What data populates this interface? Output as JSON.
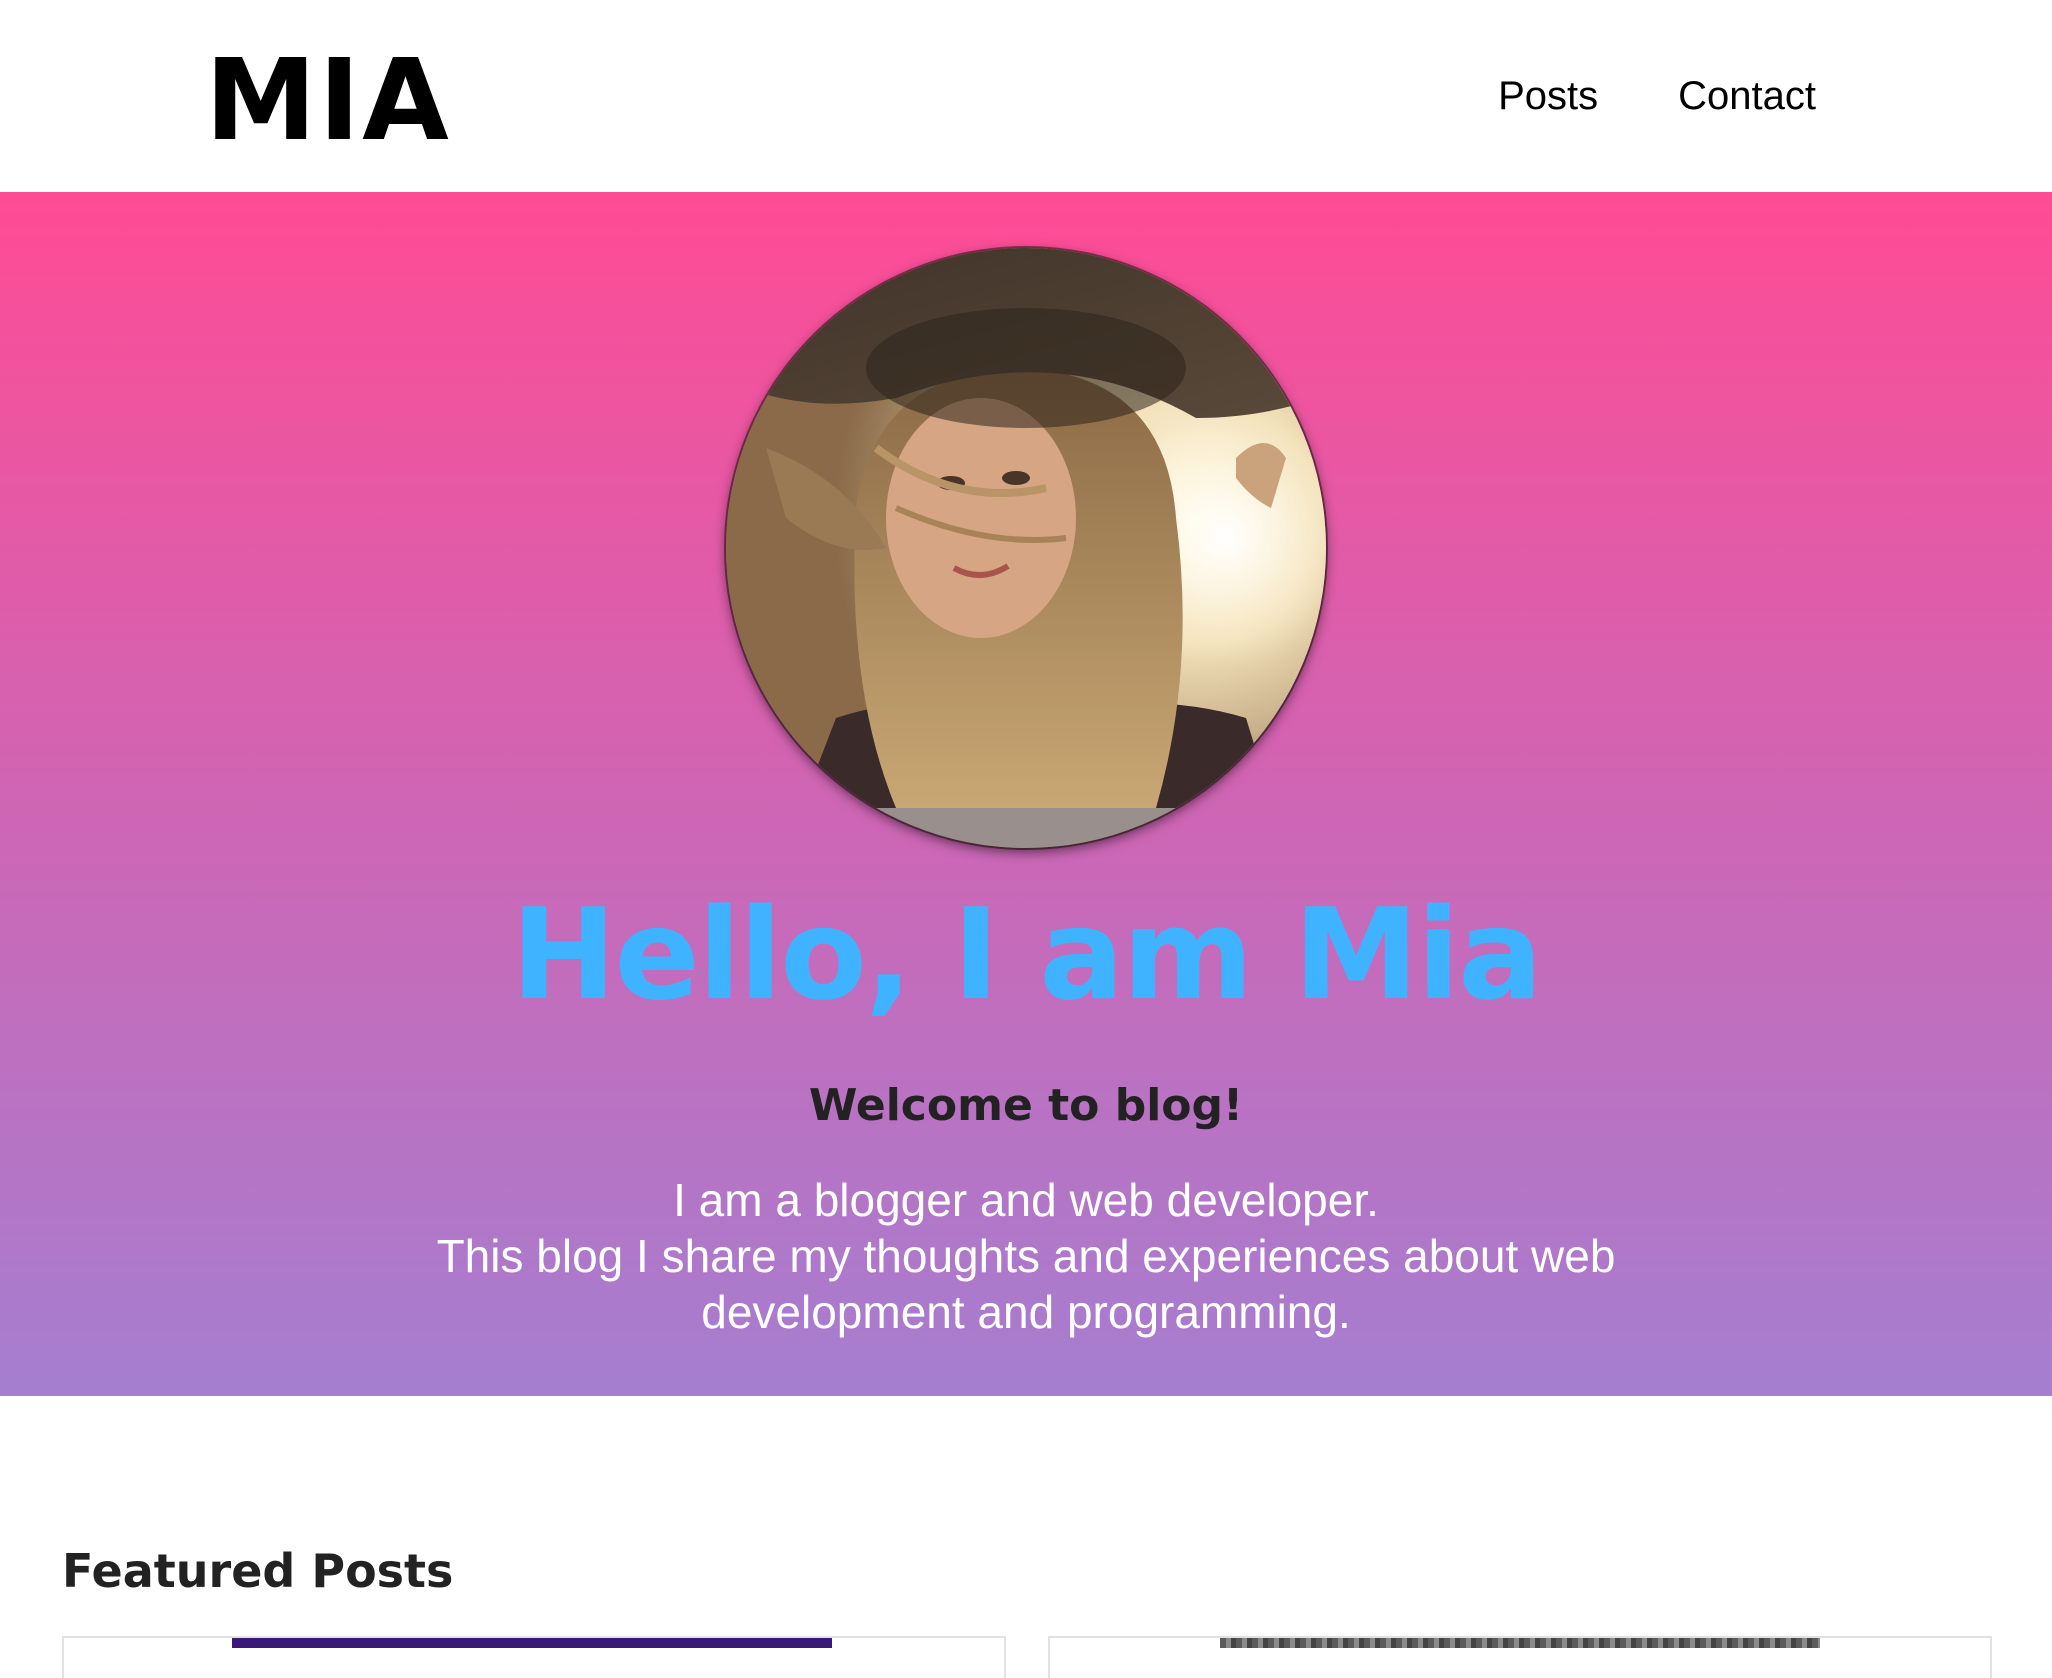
{
  "header": {
    "logo": "MIA",
    "nav": [
      "Posts",
      "Contact"
    ]
  },
  "hero": {
    "avatar_icon": "profile-photo-woman-in-hat",
    "title": "Hello, I am Mia",
    "subtitle": "Welcome to blog!",
    "text_lines": [
      "I am a blogger and web developer.",
      "This blog I share my thoughts and experiences about web",
      "development and programming."
    ]
  },
  "featured": {
    "title": "Featured Posts"
  },
  "colors": {
    "gradient_top": "#ff4b94",
    "gradient_bottom": "#a57ed0",
    "title_accent": "#3fb3ff"
  }
}
